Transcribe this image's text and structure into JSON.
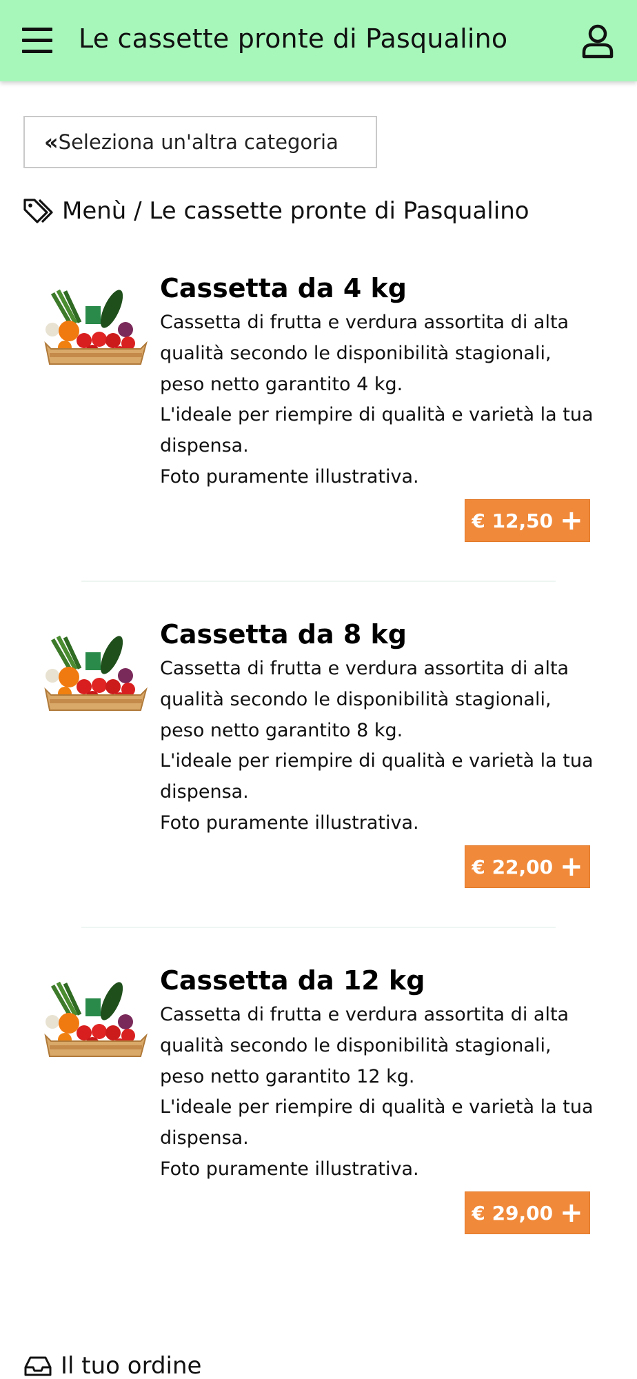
{
  "header": {
    "title": "Le cassette pronte di Pasqualino",
    "menu_icon": "hamburger-menu-icon",
    "user_icon": "user-icon"
  },
  "back_button": {
    "chevron": "«",
    "label": "Seleziona un'altra categoria"
  },
  "breadcrumb": {
    "icon": "tags-icon",
    "text": "Menù / Le cassette pronte di Pasqualino"
  },
  "products": [
    {
      "name": "Cassetta da 4 kg",
      "description": [
        "Cassetta di frutta e verdura assortita di alta qualità secondo le disponibilità stagionali, peso netto garantito 4 kg.",
        "L'ideale per riempire di qualità e varietà la tua dispensa.",
        "Foto puramente illustrativa."
      ],
      "price": "€ 12,50",
      "add_icon": "plus-icon"
    },
    {
      "name": "Cassetta da 8 kg",
      "description": [
        "Cassetta di frutta e verdura assortita di alta qualità secondo le disponibilità stagionali, peso netto garantito 8 kg.",
        "L'ideale per riempire di qualità e varietà la tua dispensa.",
        "Foto puramente illustrativa."
      ],
      "price": "€ 22,00",
      "add_icon": "plus-icon"
    },
    {
      "name": "Cassetta da 12 kg",
      "description": [
        "Cassetta di frutta e verdura assortita di alta qualità secondo le disponibilità stagionali, peso netto garantito 12 kg.",
        "L'ideale per riempire di qualità e varietà la tua dispensa.",
        "Foto puramente illustrativa."
      ],
      "price": "€ 29,00",
      "add_icon": "plus-icon"
    }
  ],
  "order_section": {
    "icon": "inbox-icon",
    "label": "Il tuo ordine"
  },
  "colors": {
    "header_bg": "#a7f7bb",
    "price_button_bg": "#f0893a",
    "text": "#111111"
  }
}
